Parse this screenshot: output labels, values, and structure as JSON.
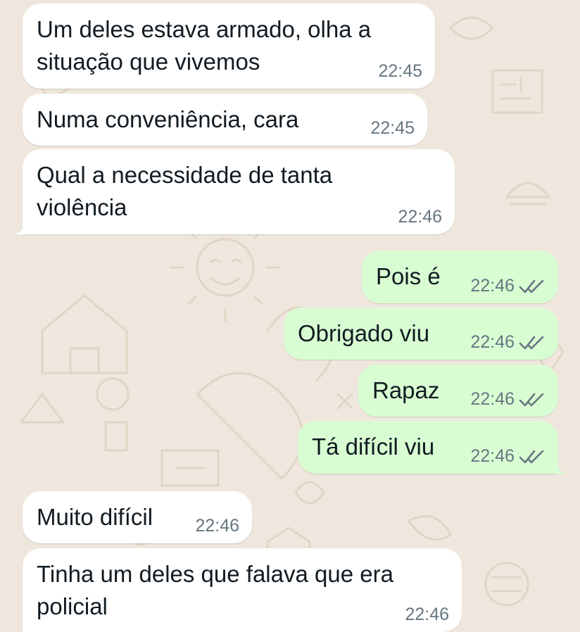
{
  "colors": {
    "wallpaper": "#efe7dd",
    "incoming_bubble": "#ffffff",
    "outgoing_bubble": "#d9fdd3",
    "timestamp": "#667781",
    "read_ticks": "#667781"
  },
  "messages": [
    {
      "direction": "in",
      "lines": [
        "Um deles estava armado, olha a",
        "situação que vivemos"
      ],
      "time": "22:45"
    },
    {
      "direction": "in",
      "lines": [
        "Numa conveniência, cara"
      ],
      "time": "22:45"
    },
    {
      "direction": "in",
      "lines": [
        "Qual a necessidade de tanta",
        "violência"
      ],
      "time": "22:46"
    },
    {
      "direction": "out",
      "lines": [
        "Pois é"
      ],
      "time": "22:46",
      "status_icon": "double-check-icon"
    },
    {
      "direction": "out",
      "lines": [
        "Obrigado viu"
      ],
      "time": "22:46",
      "status_icon": "double-check-icon"
    },
    {
      "direction": "out",
      "lines": [
        "Rapaz"
      ],
      "time": "22:46",
      "status_icon": "double-check-icon"
    },
    {
      "direction": "out",
      "lines": [
        "Tá difícil viu"
      ],
      "time": "22:46",
      "status_icon": "double-check-icon"
    },
    {
      "direction": "in",
      "lines": [
        "Muito difícil"
      ],
      "time": "22:46"
    },
    {
      "direction": "in",
      "lines": [
        "Tinha um deles que falava que era",
        "policial"
      ],
      "time": "22:46"
    }
  ]
}
